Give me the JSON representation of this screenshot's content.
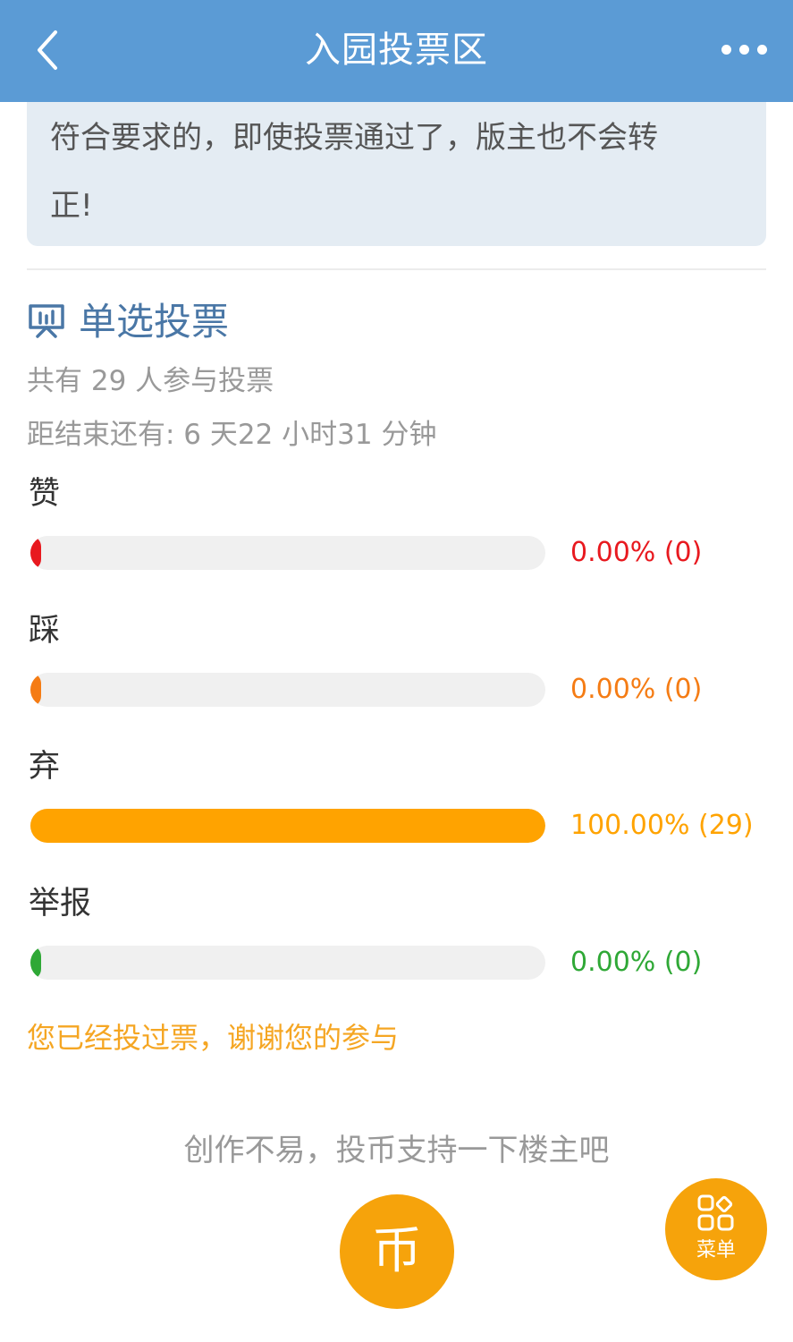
{
  "header": {
    "title": "入园投票区"
  },
  "notice": {
    "line1": "符合要求的，即使投票通过了，版主也不会转",
    "line2": "正!"
  },
  "poll": {
    "title": "单选投票",
    "participants": "共有 29 人参与投票",
    "remaining": "距结束还有: 6 天22 小时31 分钟",
    "options": [
      {
        "label": "赞",
        "percent_text": "0.00% (0)",
        "fraction": 0.0,
        "color": "#e8191f"
      },
      {
        "label": "踩",
        "percent_text": "0.00% (0)",
        "fraction": 0.0,
        "color": "#f57c14"
      },
      {
        "label": "弃",
        "percent_text": "100.00% (29)",
        "fraction": 1.0,
        "color": "#ffa300"
      },
      {
        "label": "举报",
        "percent_text": "0.00% (0)",
        "fraction": 0.0,
        "color": "#2fa836"
      }
    ],
    "voted_message": "您已经投过票，谢谢您的参与"
  },
  "footer": {
    "tip": "创作不易，投币支持一下楼主吧",
    "coin_label": "币",
    "menu_label": "菜单"
  },
  "icons": {
    "back": "chevron-left-icon",
    "more": "more-dots-icon",
    "poll": "poll-board-icon",
    "menu": "grid-menu-icon"
  }
}
